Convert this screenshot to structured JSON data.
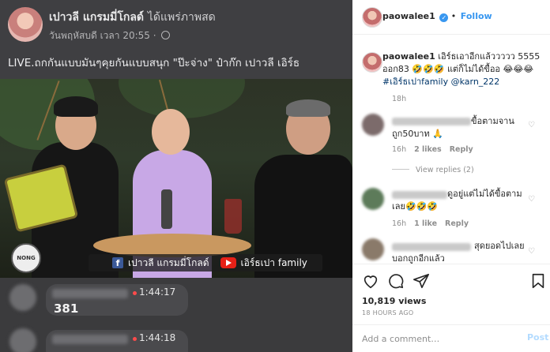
{
  "facebook_post": {
    "page_name": "เปาวลี แกรมมี่โกลด์",
    "page_name_suffix": "ได้แพร่ภาพสด",
    "timestamp": "วันพฤหัสบดี เวลา 20:55 ·",
    "caption": "LIVE.ถกกันแบบมันๆคุยกันแบบสนุก \"ป๊ะจ่าง\" ป๋าก๊ก เปาวลี เอิร์ธ"
  },
  "video": {
    "logo_text": "NONG KRATHIN",
    "brand_facebook": "เปาวลี แกรมมี่โกลด์",
    "brand_youtube": "เอิร์ธเปา family"
  },
  "live_comments": [
    {
      "time": "1:44:17",
      "text": "381"
    },
    {
      "time": "1:44:18",
      "text": ""
    }
  ],
  "instagram": {
    "username": "paowalee1",
    "follow_label": "Follow",
    "caption_text": "เอิร์ธเอาอีกแล้ววววว 5555 ออก83 🤣🤣🤣 แต่ก็ไม่ได้ขื้ออ 😂😂😂",
    "caption_tags": "#เอิร์ธเปาfamily @karn_222",
    "caption_age": "18h",
    "comments": [
      {
        "text": "ขื้อตามจาน ถูก50บาท 🙏",
        "age": "16h",
        "likes": "2 likes",
        "reply": "Reply",
        "view_replies": "View replies (2)"
      },
      {
        "text": "ดูอยู่แต่ไม่ได้ขื้อตามเลย🤣🤣🤣",
        "age": "16h",
        "likes": "1 like",
        "reply": "Reply"
      },
      {
        "text": "สุดยอดไปเลย บอกถูกอีกแล้ว",
        "age": "",
        "likes": "",
        "reply": ""
      }
    ],
    "likes_count": "10,819 views",
    "post_time": "18 HOURS AGO",
    "comment_placeholder": "Add a comment…",
    "post_label": "Post"
  }
}
